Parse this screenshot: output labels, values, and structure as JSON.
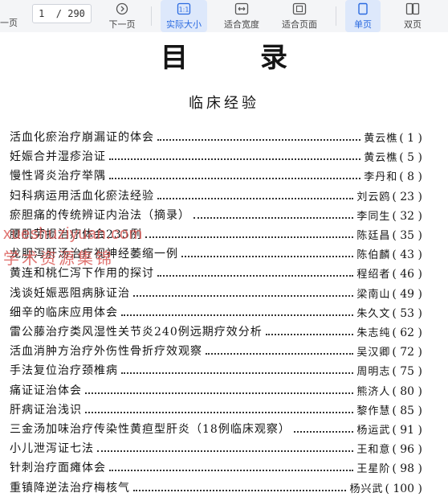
{
  "toolbar": {
    "prev_label": "一页",
    "page_current": "1",
    "page_total": "/ 290",
    "next_label": "下一页",
    "actual_size_label": "实际大小",
    "fit_width_label": "适合宽度",
    "fit_page_label": "适合页面",
    "single_page_label": "单页",
    "double_page_label": "双页"
  },
  "document": {
    "title": "目录",
    "section": "临床经验",
    "entries": [
      {
        "title": "活血化瘀治疗崩漏证的体会",
        "author": "黄云樵",
        "page": "( 1 )"
      },
      {
        "title": "妊娠合并湿疹治证",
        "author": "黄云樵",
        "page": "( 5 )"
      },
      {
        "title": "慢性肾炎治疗举隅",
        "author": "李丹和",
        "page": "( 8 )"
      },
      {
        "title": "妇科病运用活血化瘀法经验",
        "author": "刘云鸥",
        "page": "( 23 )"
      },
      {
        "title": "瘀胆痛的传统辨证内治法（摘录）",
        "author": "李同生",
        "page": "( 32 )"
      },
      {
        "title": "腰肌劳损治疗体会235例",
        "author": "陈廷昌",
        "page": "( 35 )"
      },
      {
        "title": "龙胆泻肝汤治疗视神经萎缩一例",
        "author": "陈伯麟",
        "page": "( 43 )"
      },
      {
        "title": "黄连和桃仁泻下作用的探讨",
        "author": "程绍者",
        "page": "( 46 )"
      },
      {
        "title": "浅谈妊娠恶阻病脉证治",
        "author": "梁南山",
        "page": "( 49 )"
      },
      {
        "title": "细辛的临床应用体会",
        "author": "朱久文",
        "page": "( 53 )"
      },
      {
        "title": "雷公藤治疗类风湿性关节炎240例远期疗效分析",
        "author": "朱志纯",
        "page": "( 62 )"
      },
      {
        "title": "活血消肿方治疗外伤性骨折疗效观察",
        "author": "吴汉卿",
        "page": "( 72 )"
      },
      {
        "title": "手法复位治疗颈椎病",
        "author": "周明志",
        "page": "( 75 )"
      },
      {
        "title": "痛证证治体会",
        "author": "熊济人",
        "page": "( 80 )"
      },
      {
        "title": "肝病证治浅识",
        "author": "黎作慧",
        "page": "( 85 )"
      },
      {
        "title": "三金汤加味治疗传染性黄疸型肝炎（18例临床观察）",
        "author": "杨运武",
        "page": "( 91 )"
      },
      {
        "title": "小儿泄泻证七法",
        "author": "王和意",
        "page": "( 96 )"
      },
      {
        "title": "针刺治疗面瘫体会",
        "author": "王星阶",
        "page": "( 98 )"
      },
      {
        "title": "重镇降逆法治疗梅核气",
        "author": "杨兴武",
        "page": "( 100 )"
      }
    ]
  },
  "watermark": {
    "line1": "xueshuziyuan.com",
    "line2": "学术资源集锦"
  },
  "colors": {
    "toolbar_bg": "#f4f5f7",
    "accent": "#2a6ae0",
    "watermark": "#d9534f"
  }
}
